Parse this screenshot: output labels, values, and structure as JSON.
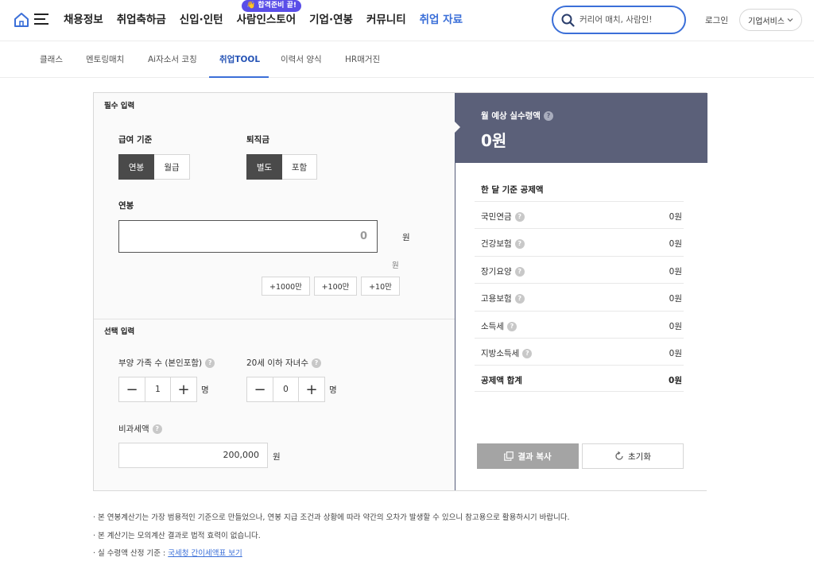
{
  "header": {
    "gnb": [
      "채용정보",
      "취업축하금",
      "신입·인턴",
      "사람인스토어",
      "기업·연봉",
      "커뮤니티",
      "취업 자료"
    ],
    "active_index": 6,
    "promo_badge": "👋 합격준비 끝!",
    "search_placeholder": "커리어 매치, 사람인!",
    "login": "로그인",
    "corp_service": "기업서비스",
    "accent_color": "#3b6fd8"
  },
  "subnav": {
    "items": [
      "클래스",
      "멘토링매치",
      "Ai자소서 코칭",
      "취업TOOL",
      "이력서 양식",
      "HR매거진"
    ],
    "active_index": 3
  },
  "calc": {
    "required_title": "필수 입력",
    "salary_basis": {
      "label": "급여 기준",
      "options": [
        "연봉",
        "월급"
      ],
      "selected": "연봉"
    },
    "severance": {
      "label": "퇴직금",
      "options": [
        "별도",
        "포함"
      ],
      "selected": "별도"
    },
    "salary": {
      "label": "연봉",
      "value": "0",
      "unit": "원",
      "sub_unit": "원"
    },
    "quick_add": [
      "+1000만",
      "+100만",
      "+10만"
    ],
    "optional_title": "선택 입력",
    "dependents": {
      "label": "부양 가족 수 (본인포함)",
      "value": "1",
      "unit": "명"
    },
    "children": {
      "label": "20세 이하 자녀수",
      "value": "0",
      "unit": "명"
    },
    "nontax": {
      "label": "비과세액",
      "value": "200,000",
      "unit": "원"
    },
    "help_mark": "?",
    "minus": "−",
    "plus": "+"
  },
  "result": {
    "label": "월 예상 실수령액",
    "value": "0원",
    "deduct_title": "한 달 기준 공제액",
    "rows": [
      {
        "name": "국민연금",
        "value": "0원"
      },
      {
        "name": "건강보험",
        "value": "0원"
      },
      {
        "name": "장기요양",
        "value": "0원"
      },
      {
        "name": "고용보험",
        "value": "0원"
      },
      {
        "name": "소득세",
        "value": "0원"
      },
      {
        "name": "지방소득세",
        "value": "0원"
      }
    ],
    "total": {
      "name": "공제액 합계",
      "value": "0원"
    },
    "copy_label": "결과 복사",
    "reset_label": "초기화",
    "head_color": "#5b6079"
  },
  "notes": {
    "line1": "· 본 연봉계산기는 가장 범용적인 기준으로 만들었으나, 연봉 지급 조건과 상황에 따라 약간의 오차가 발생할 수 있으니 참고용으로 활용하시기 바랍니다.",
    "line2": "· 본 계산기는 모의계산 결과로 법적 효력이 없습니다.",
    "line3_prefix": "· 실 수령액 산정 기준 : ",
    "line3_link": "국세청 간이세액표 보기"
  }
}
